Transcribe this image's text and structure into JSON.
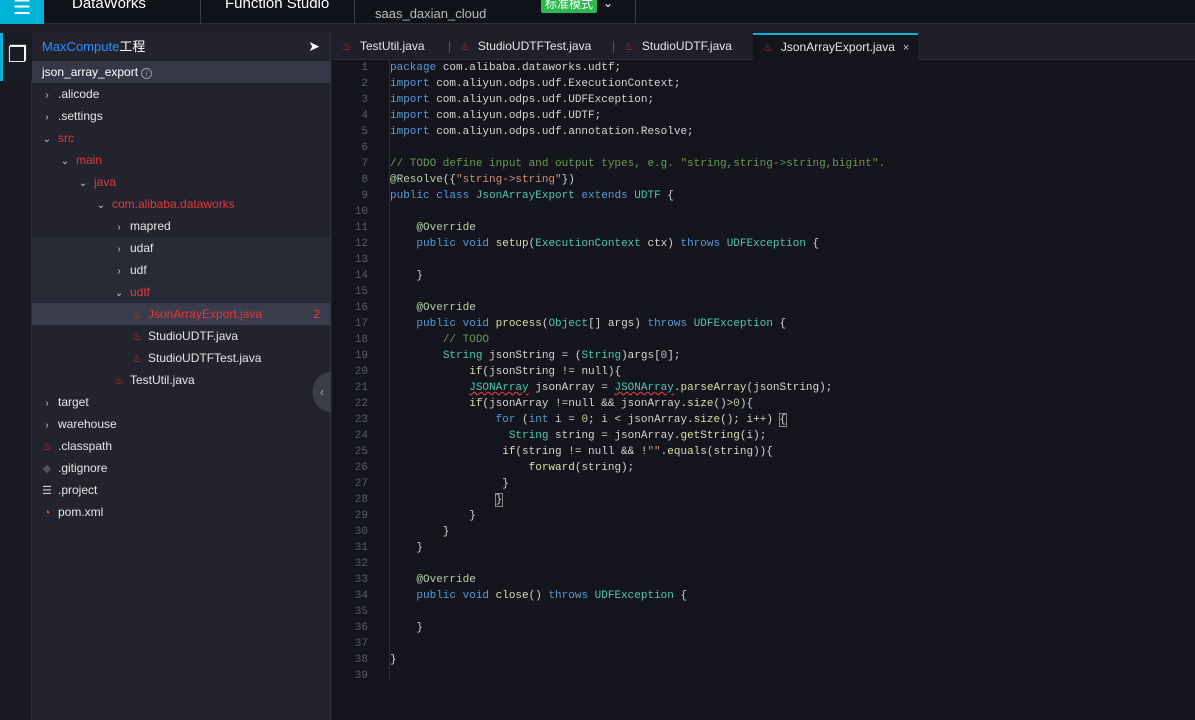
{
  "topbar": {
    "brand": "DataWorks",
    "module": "Function Studio",
    "project": "saas_daxian_cloud",
    "mode": "标准模式"
  },
  "sidebar": {
    "title_brand": "MaxCompute",
    "title_suffix": "工程",
    "project": "json_array_export",
    "tree": [
      {
        "label": ".alicode",
        "caret": "›",
        "icon": "",
        "style": ""
      },
      {
        "label": ".settings",
        "caret": "›",
        "icon": "",
        "style": ""
      },
      {
        "label": "src",
        "caret": "⌄",
        "icon": "",
        "style": "red",
        "indent": 0
      },
      {
        "label": "main",
        "caret": "⌄",
        "icon": "",
        "style": "red",
        "indent": 1
      },
      {
        "label": "java",
        "caret": "⌄",
        "icon": "",
        "style": "red",
        "indent": 2
      },
      {
        "label": "com.alibaba.dataworks",
        "caret": "⌄",
        "icon": "",
        "style": "red",
        "indent": 3
      },
      {
        "label": "mapred",
        "caret": "›",
        "icon": "",
        "style": "",
        "indent": 4
      },
      {
        "label": "udaf",
        "caret": "›",
        "icon": "",
        "style": "band",
        "indent": 4
      },
      {
        "label": "udf",
        "caret": "›",
        "icon": "",
        "style": "band",
        "indent": 4
      },
      {
        "label": "udtf",
        "caret": "⌄",
        "icon": "",
        "style": "red band",
        "indent": 4
      },
      {
        "label": "JsonArrayExport.java",
        "caret": "",
        "icon": "java-file",
        "style": "red sel",
        "indent": 5,
        "badge": "2"
      },
      {
        "label": "StudioUDTF.java",
        "caret": "",
        "icon": "java-file",
        "style": "",
        "indent": 5
      },
      {
        "label": "StudioUDTFTest.java",
        "caret": "",
        "icon": "java-file",
        "style": "",
        "indent": 5
      },
      {
        "label": "TestUtil.java",
        "caret": "",
        "icon": "java-file",
        "style": "",
        "indent": 4
      },
      {
        "label": "target",
        "caret": "›",
        "icon": "",
        "style": "",
        "indent": 0
      },
      {
        "label": "warehouse",
        "caret": "›",
        "icon": "",
        "style": "",
        "indent": 0
      },
      {
        "label": ".classpath",
        "caret": "",
        "icon": "java-file",
        "style": "",
        "indent": 0
      },
      {
        "label": ".gitignore",
        "caret": "",
        "icon": "git-file",
        "style": "",
        "indent": 0
      },
      {
        "label": ".project",
        "caret": "",
        "icon": "text-file",
        "style": "",
        "indent": 0
      },
      {
        "label": "pom.xml",
        "caret": "",
        "icon": "rss-file",
        "style": "",
        "indent": 0
      }
    ]
  },
  "tabs": [
    {
      "label": "TestUtil.java",
      "active": false
    },
    {
      "label": "StudioUDTFTest.java",
      "active": false
    },
    {
      "label": "StudioUDTF.java",
      "active": false
    },
    {
      "label": "JsonArrayExport.java",
      "active": true
    }
  ],
  "colors": {
    "accent": "#00b4d8",
    "error": "#e0383e",
    "mode_badge": "#2db84d"
  },
  "code": [
    [
      [
        "k",
        "package"
      ],
      [
        "p",
        " com.alibaba.dataworks.udtf;"
      ]
    ],
    [
      [
        "k",
        "import"
      ],
      [
        "p",
        " com.aliyun.odps.udf.ExecutionContext;"
      ]
    ],
    [
      [
        "k",
        "import"
      ],
      [
        "p",
        " com.aliyun.odps.udf.UDFException;"
      ]
    ],
    [
      [
        "k",
        "import"
      ],
      [
        "p",
        " com.aliyun.odps.udf.UDTF;"
      ]
    ],
    [
      [
        "k",
        "import"
      ],
      [
        "p",
        " com.aliyun.odps.udf.annotation.Resolve;"
      ]
    ],
    [],
    [
      [
        "c",
        "// TODO define input and output types, e.g. \"string,string->string,bigint\"."
      ]
    ],
    [
      [
        "a",
        "@Resolve"
      ],
      [
        "p",
        "({"
      ],
      [
        "s",
        "\"string->string\""
      ],
      [
        "p",
        "})"
      ]
    ],
    [
      [
        "k",
        "public class "
      ],
      [
        "t",
        "JsonArrayExport"
      ],
      [
        "k",
        " extends "
      ],
      [
        "t",
        "UDTF"
      ],
      [
        "p",
        " {"
      ]
    ],
    [],
    [
      [
        "p",
        "    "
      ],
      [
        "a",
        "@Override"
      ]
    ],
    [
      [
        "p",
        "    "
      ],
      [
        "k",
        "public void "
      ],
      [
        "f",
        "setup"
      ],
      [
        "p",
        "("
      ],
      [
        "t",
        "ExecutionContext"
      ],
      [
        "p",
        " ctx) "
      ],
      [
        "k",
        "throws "
      ],
      [
        "t",
        "UDFException"
      ],
      [
        "p",
        " {"
      ]
    ],
    [],
    [
      [
        "p",
        "    }"
      ]
    ],
    [],
    [
      [
        "p",
        "    "
      ],
      [
        "a",
        "@Override"
      ]
    ],
    [
      [
        "p",
        "    "
      ],
      [
        "k",
        "public void "
      ],
      [
        "f",
        "process"
      ],
      [
        "p",
        "("
      ],
      [
        "t",
        "Object"
      ],
      [
        "p",
        "[] args) "
      ],
      [
        "k",
        "throws "
      ],
      [
        "t",
        "UDFException"
      ],
      [
        "p",
        " {"
      ]
    ],
    [
      [
        "p",
        "        "
      ],
      [
        "c",
        "// TODO"
      ]
    ],
    [
      [
        "p",
        "        "
      ],
      [
        "t",
        "String"
      ],
      [
        "p",
        " jsonString = ("
      ],
      [
        "t",
        "String"
      ],
      [
        "p",
        ")args["
      ],
      [
        "n",
        "0"
      ],
      [
        "p",
        "];"
      ]
    ],
    [
      [
        "p",
        "            "
      ],
      [
        "f",
        "if"
      ],
      [
        "p",
        "(jsonString != null){"
      ]
    ],
    [
      [
        "p",
        "            "
      ],
      [
        "t err",
        "JSONArray"
      ],
      [
        "p",
        " jsonArray = "
      ],
      [
        "t err",
        "JSONArray"
      ],
      [
        "p",
        "."
      ],
      [
        "f",
        "parseArray"
      ],
      [
        "p",
        "(jsonString);"
      ]
    ],
    [
      [
        "p",
        "            "
      ],
      [
        "f",
        "if"
      ],
      [
        "p",
        "(jsonArray !=null && jsonArray."
      ],
      [
        "f",
        "size"
      ],
      [
        "p",
        "()>"
      ],
      [
        "n",
        "0"
      ],
      [
        "p",
        "){"
      ]
    ],
    [
      [
        "p",
        "                "
      ],
      [
        "k",
        "for"
      ],
      [
        "p",
        " ("
      ],
      [
        "k",
        "int"
      ],
      [
        "p",
        " i = "
      ],
      [
        "n",
        "0"
      ],
      [
        "p",
        "; i < jsonArray."
      ],
      [
        "f",
        "size"
      ],
      [
        "p",
        "(); i++) "
      ],
      [
        "p br",
        "{"
      ]
    ],
    [
      [
        "p",
        "                  "
      ],
      [
        "t",
        "String"
      ],
      [
        "p",
        " string = jsonArray."
      ],
      [
        "f",
        "getString"
      ],
      [
        "p",
        "(i);"
      ]
    ],
    [
      [
        "p",
        "                 "
      ],
      [
        "f",
        "if"
      ],
      [
        "p",
        "(string != null && !"
      ],
      [
        "s",
        "\"\""
      ],
      [
        "p",
        "."
      ],
      [
        "f",
        "equals"
      ],
      [
        "p",
        "(string)){"
      ]
    ],
    [
      [
        "p",
        "                     "
      ],
      [
        "f",
        "forward"
      ],
      [
        "p",
        "(string);"
      ]
    ],
    [
      [
        "p",
        "                 }"
      ]
    ],
    [
      [
        "p",
        "                "
      ],
      [
        "p br",
        "}"
      ]
    ],
    [
      [
        "p",
        "            }"
      ]
    ],
    [
      [
        "p",
        "        }"
      ]
    ],
    [
      [
        "p",
        "    }"
      ]
    ],
    [],
    [
      [
        "p",
        "    "
      ],
      [
        "a",
        "@Override"
      ]
    ],
    [
      [
        "p",
        "    "
      ],
      [
        "k",
        "public void "
      ],
      [
        "f",
        "close"
      ],
      [
        "p",
        "() "
      ],
      [
        "k",
        "throws "
      ],
      [
        "t",
        "UDFException"
      ],
      [
        "p",
        " {"
      ]
    ],
    [],
    [
      [
        "p",
        "    }"
      ]
    ],
    [],
    [
      [
        "p",
        "}"
      ]
    ],
    []
  ]
}
